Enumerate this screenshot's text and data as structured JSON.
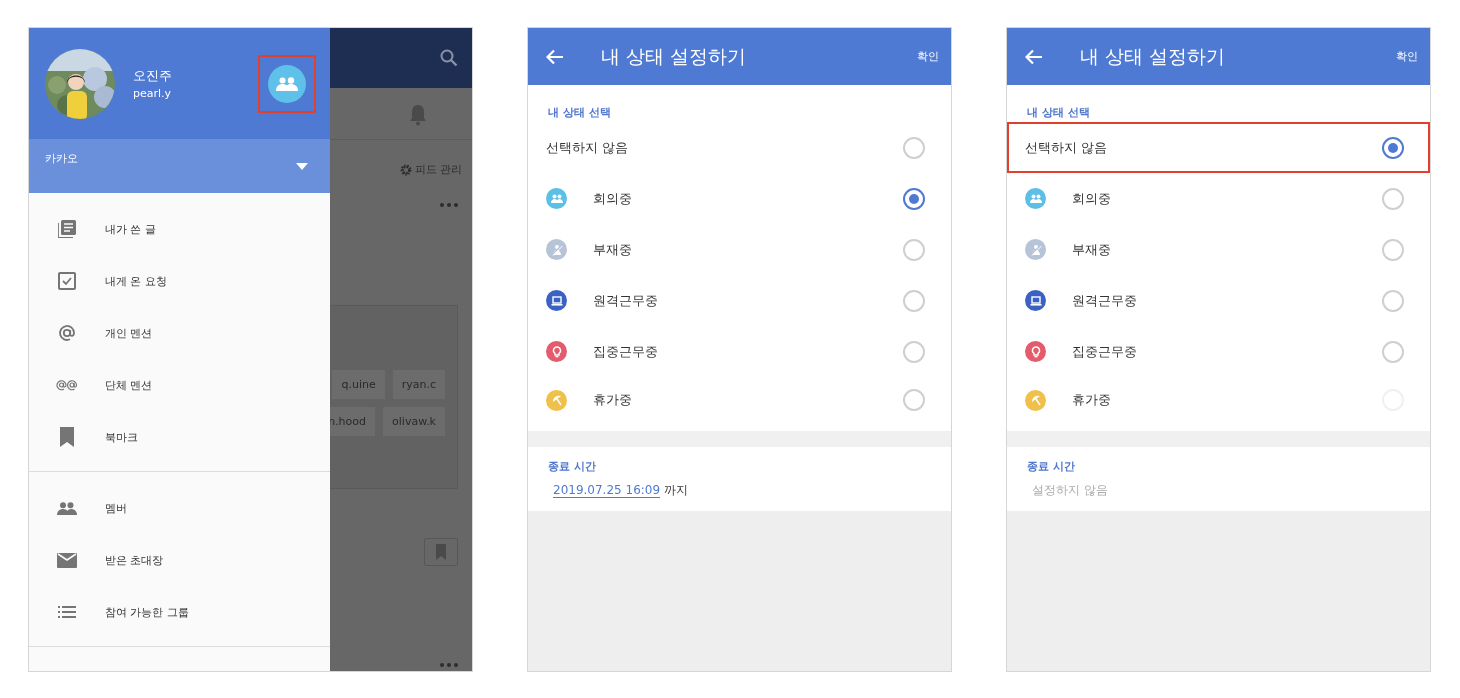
{
  "drawer_screen": {
    "profile": {
      "name": "오진주",
      "id": "pearl.y",
      "member_button_highlighted": true
    },
    "org": {
      "label": "카카오"
    },
    "menu_groups": [
      [
        {
          "label": "내가 쓴 글"
        },
        {
          "label": "내게 온 요청"
        },
        {
          "label": "개인 멘션"
        },
        {
          "label": "단체 멘션"
        },
        {
          "label": "북마크"
        }
      ],
      [
        {
          "label": "멤버"
        },
        {
          "label": "받은 초대장"
        },
        {
          "label": "참여 가능한 그룹"
        }
      ]
    ],
    "background": {
      "feed_settings": "피드 관리",
      "chips": [
        "q.uine",
        "ryan.c",
        "n.hood",
        "olivaw.k"
      ]
    }
  },
  "status_screens": [
    {
      "title": "내 상태 설정하기",
      "confirm": "확인",
      "section_label": "내 상태 선택",
      "options": [
        {
          "label": "선택하지 않음",
          "selected": false,
          "highlighted": false,
          "disabled": false
        },
        {
          "label": "회의중",
          "color": "#5bbfe6",
          "selected": true,
          "highlighted": false,
          "disabled": false
        },
        {
          "label": "부재중",
          "color": "#b7c3d6",
          "selected": false,
          "highlighted": false,
          "disabled": false
        },
        {
          "label": "원격근무중",
          "color": "#3a62c4",
          "selected": false,
          "highlighted": false,
          "disabled": false
        },
        {
          "label": "집중근무중",
          "color": "#e45b6b",
          "selected": false,
          "highlighted": false,
          "disabled": false
        },
        {
          "label": "휴가중",
          "color": "#efc04a",
          "selected": false,
          "highlighted": false,
          "disabled": false
        }
      ],
      "end_time": {
        "label": "종료 시간",
        "kind": "set",
        "value": "2019.07.25 16:09",
        "suffix": "까지"
      }
    },
    {
      "title": "내 상태 설정하기",
      "confirm": "확인",
      "section_label": "내 상태 선택",
      "options": [
        {
          "label": "선택하지 않음",
          "selected": true,
          "highlighted": true,
          "disabled": false
        },
        {
          "label": "회의중",
          "color": "#5bbfe6",
          "selected": false,
          "highlighted": false,
          "disabled": false
        },
        {
          "label": "부재중",
          "color": "#b7c3d6",
          "selected": false,
          "highlighted": false,
          "disabled": false
        },
        {
          "label": "원격근무중",
          "color": "#3a62c4",
          "selected": false,
          "highlighted": false,
          "disabled": false
        },
        {
          "label": "집중근무중",
          "color": "#e45b6b",
          "selected": false,
          "highlighted": false,
          "disabled": false
        },
        {
          "label": "휴가중",
          "color": "#efc04a",
          "selected": false,
          "highlighted": false,
          "disabled": true
        }
      ],
      "end_time": {
        "label": "종료 시간",
        "kind": "unset",
        "value": "설정하지 않음"
      }
    }
  ]
}
